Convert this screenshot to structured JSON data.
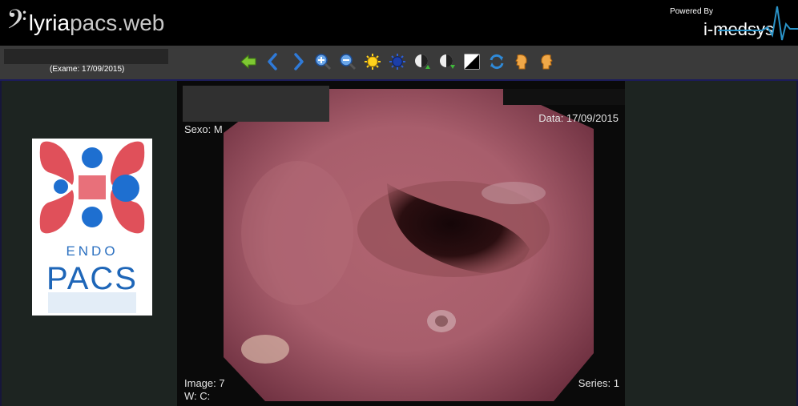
{
  "header": {
    "logo_prefix": "lyria",
    "logo_suffix": "pacs.web",
    "powered_by": "Powered By",
    "brand": "i-medsys"
  },
  "toolbar": {
    "exam_date": "(Exame: 17/09/2015)",
    "tools": [
      {
        "name": "back-arrow-icon"
      },
      {
        "name": "previous-icon"
      },
      {
        "name": "next-icon"
      },
      {
        "name": "zoom-in-icon"
      },
      {
        "name": "zoom-out-icon"
      },
      {
        "name": "brightness-icon"
      },
      {
        "name": "contrast-icon"
      },
      {
        "name": "window-level-up-icon"
      },
      {
        "name": "window-level-down-icon"
      },
      {
        "name": "invert-icon"
      },
      {
        "name": "refresh-icon"
      },
      {
        "name": "face-left-icon"
      },
      {
        "name": "face-right-icon"
      }
    ]
  },
  "sidebar": {
    "thumb_line1": "ENDO",
    "thumb_line2": "PACS"
  },
  "overlay": {
    "sex": "Sexo:  M",
    "date": "Data: 17/09/2015",
    "image": "Image: 7",
    "wc": "W: C:",
    "series": "Series: 1"
  },
  "colors": {
    "toolbar_bg": "#3a3a3a",
    "viewer_bg": "#1d2421",
    "accent_blue": "#1560c8",
    "logo_red": "#e0303a"
  }
}
